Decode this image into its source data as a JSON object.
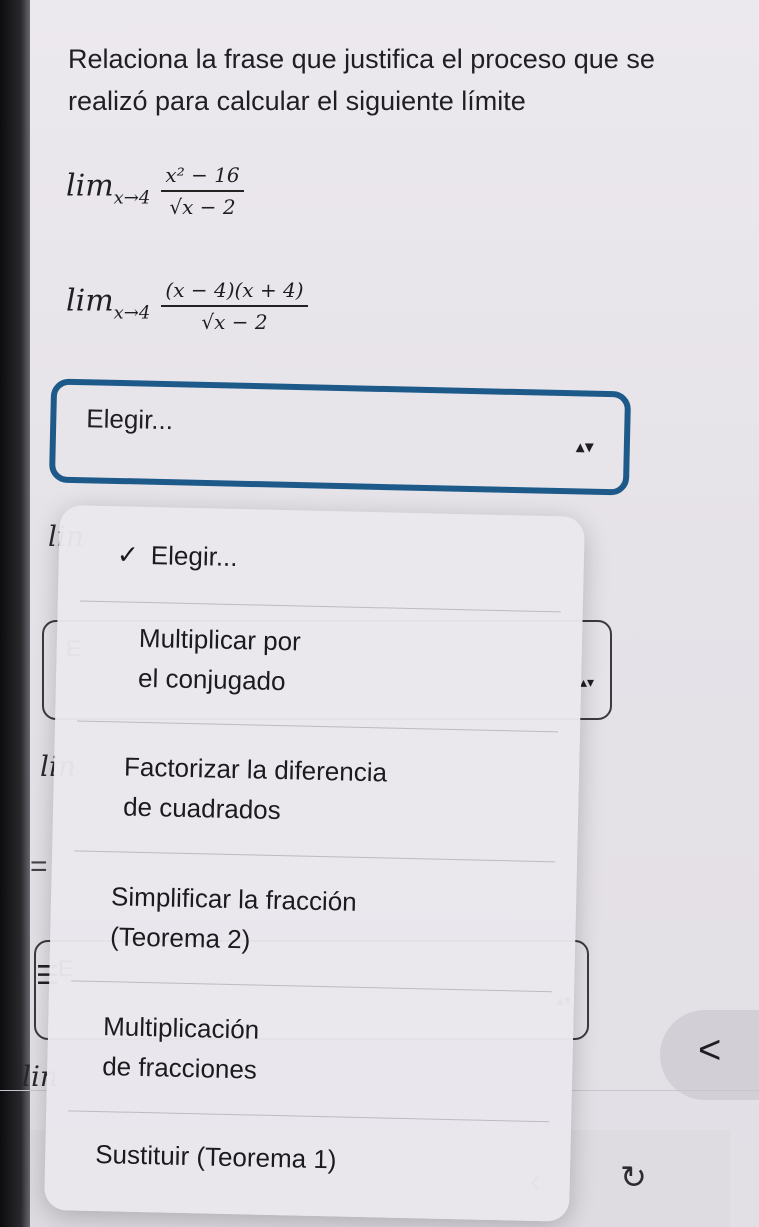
{
  "question": {
    "line1": "Relaciona la frase que justifica el proceso que se",
    "line2": "realizó para calcular el siguiente límite"
  },
  "math1": {
    "lim": "lim",
    "sub": "x→4",
    "num": "x² − 16",
    "den": "√x − 2"
  },
  "math2": {
    "lim": "lim",
    "sub": "x→4",
    "num": "(x − 4)(x + 4)",
    "den": "√x − 2"
  },
  "select_main": {
    "label": "Elegir...",
    "arrows": "▴▾"
  },
  "background": {
    "lin": "lin",
    "e": "E",
    "equals": "="
  },
  "dropdown": {
    "options": [
      {
        "label_line1": "Elegir...",
        "checked": true,
        "check_glyph": "✓"
      },
      {
        "label_line1": "Multiplicar por",
        "label_line2": "el conjugado"
      },
      {
        "label_line1": "Factorizar la diferencia",
        "label_line2": "de cuadrados"
      },
      {
        "label_line1": "Simplificar la fracción",
        "label_line2": "(Teorema 2)"
      },
      {
        "label_line1": "Multiplicación",
        "label_line2": "de fracciones"
      },
      {
        "label_line1": "Sustituir (Teorema 1)"
      }
    ]
  },
  "nav": {
    "back_glyph": "<",
    "toolbar_back": "‹",
    "reload_glyph": "↻"
  },
  "colors": {
    "select_border": "#1d5a8a",
    "page_bg": "#e9e6ea"
  }
}
